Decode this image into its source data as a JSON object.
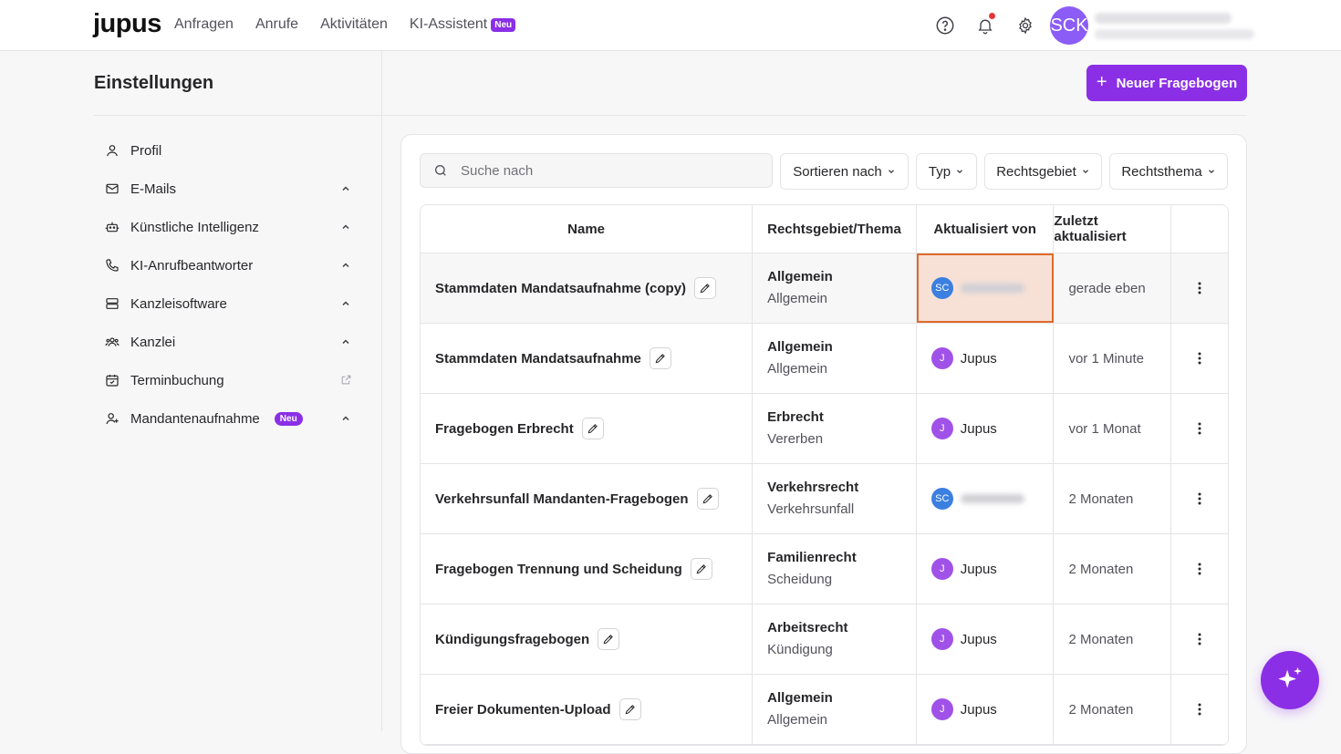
{
  "brand": {
    "logo": "jupus",
    "accent": "#8b2fe6"
  },
  "topnav": {
    "items": [
      {
        "label": "Anfragen"
      },
      {
        "label": "Anrufe"
      },
      {
        "label": "Aktivitäten"
      },
      {
        "label": "KI-Assistent",
        "badge": "Neu"
      }
    ],
    "icons": [
      "help-icon",
      "bell-icon",
      "gear-icon"
    ],
    "avatar_initials": "SCK"
  },
  "sidebar": {
    "title": "Einstellungen",
    "items": [
      {
        "label": "Profil",
        "icon": "user-icon"
      },
      {
        "label": "E-Mails",
        "icon": "mail-icon",
        "chevron": true
      },
      {
        "label": "Künstliche Intelligenz",
        "icon": "robot-icon",
        "chevron": true
      },
      {
        "label": "KI-Anrufbeantworter",
        "icon": "phone-icon",
        "chevron": true
      },
      {
        "label": "Kanzleisoftware",
        "icon": "server-icon",
        "chevron": true
      },
      {
        "label": "Kanzlei",
        "icon": "users-icon",
        "chevron": true
      },
      {
        "label": "Terminbuchung",
        "icon": "calendar-icon",
        "external": true
      },
      {
        "label": "Mandantenaufnahme",
        "icon": "user-plus-icon",
        "badge": "Neu",
        "chevron": true
      }
    ]
  },
  "actions": {
    "new_button": "Neuer Fragebogen"
  },
  "search": {
    "placeholder": "Suche nach",
    "value": ""
  },
  "filters": {
    "sort": "Sortieren nach",
    "type": "Typ",
    "area": "Rechtsgebiet",
    "topic": "Rechtsthema"
  },
  "table": {
    "headers": {
      "name": "Name",
      "area": "Rechtsgebiet/Thema",
      "updated_by": "Aktualisiert von",
      "updated_at": "Zuletzt aktualisiert"
    },
    "rows": [
      {
        "name": "Stammdaten Mandatsaufnahme (copy)",
        "area": "Allgemein",
        "topic": "Allgemein",
        "by_initials": "SC",
        "by_name": "",
        "when": "gerade eben"
      },
      {
        "name": "Stammdaten Mandatsaufnahme",
        "area": "Allgemein",
        "topic": "Allgemein",
        "by_initials": "J",
        "by_name": "Jupus",
        "when": "vor 1 Minute"
      },
      {
        "name": "Fragebogen Erbrecht",
        "area": "Erbrecht",
        "topic": "Vererben",
        "by_initials": "J",
        "by_name": "Jupus",
        "when": "vor 1 Monat"
      },
      {
        "name": "Verkehrsunfall Mandanten-Fragebogen",
        "area": "Verkehrsrecht",
        "topic": "Verkehrsunfall",
        "by_initials": "SC",
        "by_name": "",
        "when": "2 Monaten"
      },
      {
        "name": "Fragebogen Trennung und Scheidung",
        "area": "Familienrecht",
        "topic": "Scheidung",
        "by_initials": "J",
        "by_name": "Jupus",
        "when": "2 Monaten"
      },
      {
        "name": "Kündigungsfragebogen",
        "area": "Arbeitsrecht",
        "topic": "Kündigung",
        "by_initials": "J",
        "by_name": "Jupus",
        "when": "2 Monaten"
      },
      {
        "name": "Freier Dokumenten-Upload",
        "area": "Allgemein",
        "topic": "Allgemein",
        "by_initials": "J",
        "by_name": "Jupus",
        "when": "2 Monaten"
      }
    ]
  }
}
